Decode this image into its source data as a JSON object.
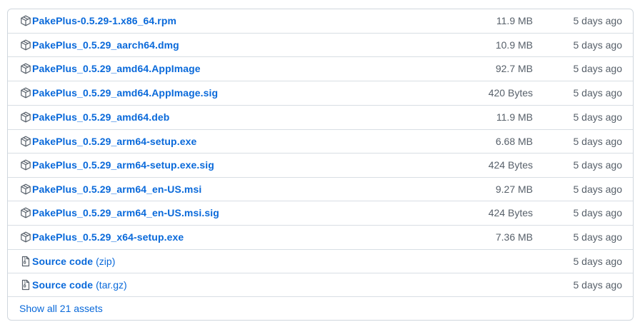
{
  "assets": [
    {
      "name": "PakePlus-0.5.29-1.x86_64.rpm",
      "size": "11.9 MB",
      "date": "5 days ago",
      "icon": "package-icon"
    },
    {
      "name": "PakePlus_0.5.29_aarch64.dmg",
      "size": "10.9 MB",
      "date": "5 days ago",
      "icon": "package-icon"
    },
    {
      "name": "PakePlus_0.5.29_amd64.AppImage",
      "size": "92.7 MB",
      "date": "5 days ago",
      "icon": "package-icon"
    },
    {
      "name": "PakePlus_0.5.29_amd64.AppImage.sig",
      "size": "420 Bytes",
      "date": "5 days ago",
      "icon": "package-icon"
    },
    {
      "name": "PakePlus_0.5.29_amd64.deb",
      "size": "11.9 MB",
      "date": "5 days ago",
      "icon": "package-icon"
    },
    {
      "name": "PakePlus_0.5.29_arm64-setup.exe",
      "size": "6.68 MB",
      "date": "5 days ago",
      "icon": "package-icon"
    },
    {
      "name": "PakePlus_0.5.29_arm64-setup.exe.sig",
      "size": "424 Bytes",
      "date": "5 days ago",
      "icon": "package-icon"
    },
    {
      "name": "PakePlus_0.5.29_arm64_en-US.msi",
      "size": "9.27 MB",
      "date": "5 days ago",
      "icon": "package-icon"
    },
    {
      "name": "PakePlus_0.5.29_arm64_en-US.msi.sig",
      "size": "424 Bytes",
      "date": "5 days ago",
      "icon": "package-icon"
    },
    {
      "name": "PakePlus_0.5.29_x64-setup.exe",
      "size": "7.36 MB",
      "date": "5 days ago",
      "icon": "package-icon"
    }
  ],
  "source": [
    {
      "name": "Source code",
      "suffix": "(zip)",
      "date": "5 days ago",
      "icon": "file-zip-icon"
    },
    {
      "name": "Source code",
      "suffix": "(tar.gz)",
      "date": "5 days ago",
      "icon": "file-zip-icon"
    }
  ],
  "show_all_label": "Show all 21 assets",
  "colors": {
    "link": "#0969da",
    "muted": "#57606a",
    "border": "#d0d7de"
  }
}
